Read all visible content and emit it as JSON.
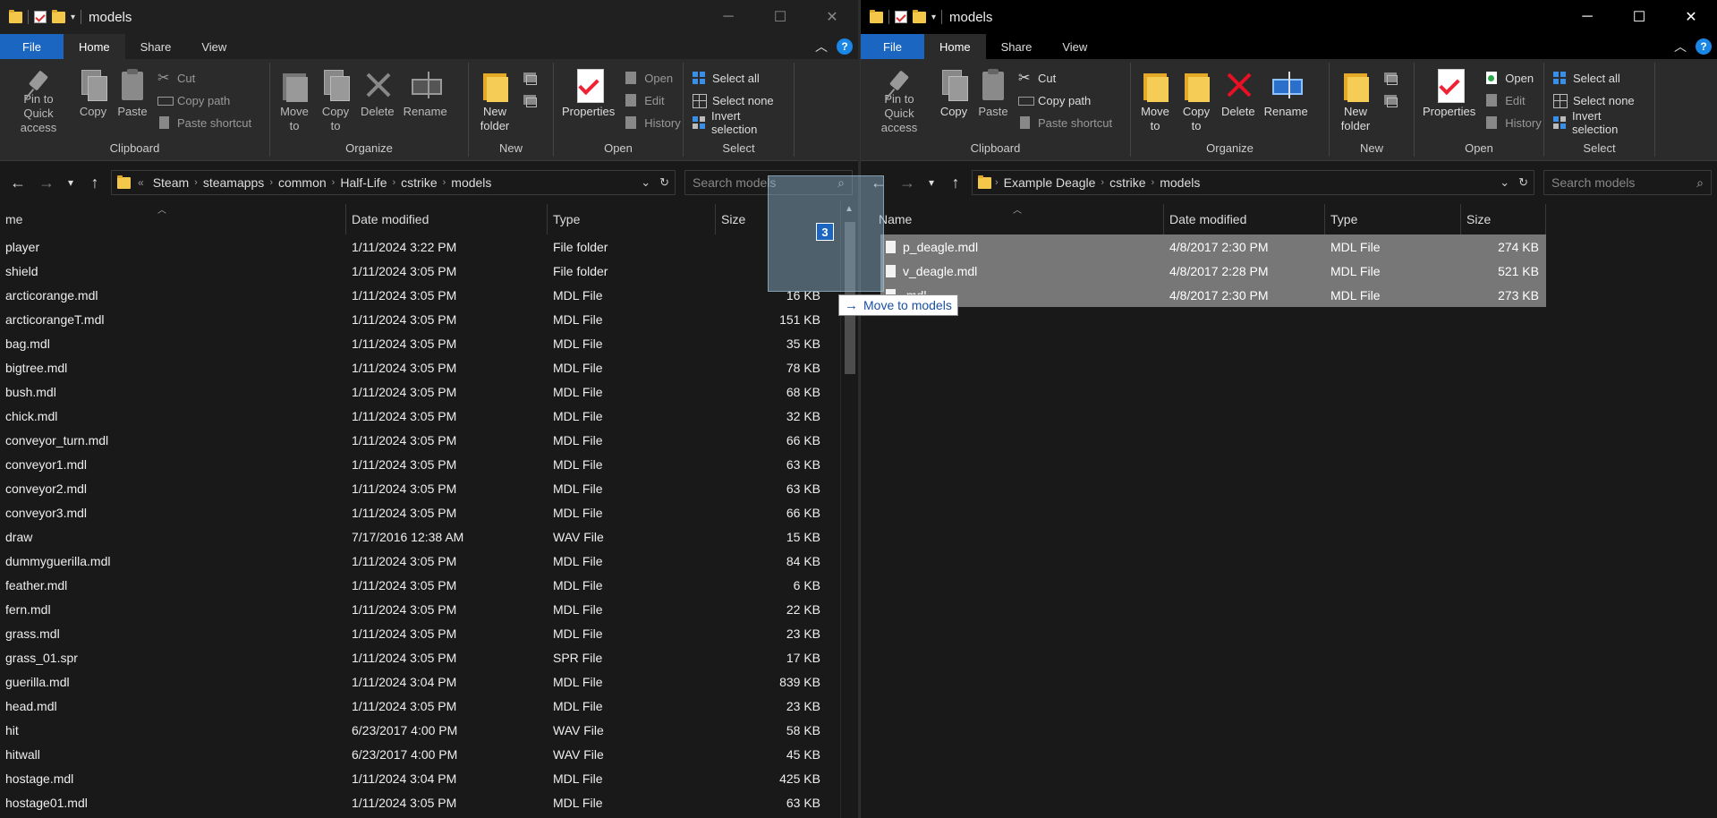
{
  "left": {
    "title": "models",
    "tabs": [
      "File",
      "Home",
      "Share",
      "View"
    ],
    "ribbon": {
      "clipboard": {
        "pin": "Pin to Quick access",
        "copy": "Copy",
        "paste": "Paste",
        "cut": "Cut",
        "copy_path": "Copy path",
        "paste_shortcut": "Paste shortcut",
        "label": "Clipboard"
      },
      "organize": {
        "move_to": "Move to",
        "copy_to": "Copy to",
        "delete": "Delete",
        "rename": "Rename",
        "label": "Organize"
      },
      "new": {
        "new_folder": "New folder",
        "label": "New"
      },
      "open": {
        "properties": "Properties",
        "open": "Open",
        "edit": "Edit",
        "history": "History",
        "label": "Open"
      },
      "select": {
        "select_all": "Select all",
        "select_none": "Select none",
        "invert": "Invert selection",
        "label": "Select"
      }
    },
    "address": {
      "overflow": "«",
      "crumbs": [
        "Steam",
        "steamapps",
        "common",
        "Half-Life",
        "cstrike",
        "models"
      ]
    },
    "search_placeholder": "Search models",
    "columns": {
      "name": "me",
      "date": "Date modified",
      "type": "Type",
      "size": "Size"
    },
    "files": [
      {
        "name": "player",
        "date": "1/11/2024 3:22 PM",
        "type": "File folder",
        "size": ""
      },
      {
        "name": "shield",
        "date": "1/11/2024 3:05 PM",
        "type": "File folder",
        "size": ""
      },
      {
        "name": "arcticorange.mdl",
        "date": "1/11/2024 3:05 PM",
        "type": "MDL File",
        "size": "16 KB"
      },
      {
        "name": "arcticorangeT.mdl",
        "date": "1/11/2024 3:05 PM",
        "type": "MDL File",
        "size": "151 KB"
      },
      {
        "name": "bag.mdl",
        "date": "1/11/2024 3:05 PM",
        "type": "MDL File",
        "size": "35 KB"
      },
      {
        "name": "bigtree.mdl",
        "date": "1/11/2024 3:05 PM",
        "type": "MDL File",
        "size": "78 KB"
      },
      {
        "name": "bush.mdl",
        "date": "1/11/2024 3:05 PM",
        "type": "MDL File",
        "size": "68 KB"
      },
      {
        "name": "chick.mdl",
        "date": "1/11/2024 3:05 PM",
        "type": "MDL File",
        "size": "32 KB"
      },
      {
        "name": "conveyor_turn.mdl",
        "date": "1/11/2024 3:05 PM",
        "type": "MDL File",
        "size": "66 KB"
      },
      {
        "name": "conveyor1.mdl",
        "date": "1/11/2024 3:05 PM",
        "type": "MDL File",
        "size": "63 KB"
      },
      {
        "name": "conveyor2.mdl",
        "date": "1/11/2024 3:05 PM",
        "type": "MDL File",
        "size": "63 KB"
      },
      {
        "name": "conveyor3.mdl",
        "date": "1/11/2024 3:05 PM",
        "type": "MDL File",
        "size": "66 KB"
      },
      {
        "name": "draw",
        "date": "7/17/2016 12:38 AM",
        "type": "WAV File",
        "size": "15 KB"
      },
      {
        "name": "dummyguerilla.mdl",
        "date": "1/11/2024 3:05 PM",
        "type": "MDL File",
        "size": "84 KB"
      },
      {
        "name": "feather.mdl",
        "date": "1/11/2024 3:05 PM",
        "type": "MDL File",
        "size": "6 KB"
      },
      {
        "name": "fern.mdl",
        "date": "1/11/2024 3:05 PM",
        "type": "MDL File",
        "size": "22 KB"
      },
      {
        "name": "grass.mdl",
        "date": "1/11/2024 3:05 PM",
        "type": "MDL File",
        "size": "23 KB"
      },
      {
        "name": "grass_01.spr",
        "date": "1/11/2024 3:05 PM",
        "type": "SPR File",
        "size": "17 KB"
      },
      {
        "name": "guerilla.mdl",
        "date": "1/11/2024 3:04 PM",
        "type": "MDL File",
        "size": "839 KB"
      },
      {
        "name": "head.mdl",
        "date": "1/11/2024 3:05 PM",
        "type": "MDL File",
        "size": "23 KB"
      },
      {
        "name": "hit",
        "date": "6/23/2017 4:00 PM",
        "type": "WAV File",
        "size": "58 KB"
      },
      {
        "name": "hitwall",
        "date": "6/23/2017 4:00 PM",
        "type": "WAV File",
        "size": "45 KB"
      },
      {
        "name": "hostage.mdl",
        "date": "1/11/2024 3:04 PM",
        "type": "MDL File",
        "size": "425 KB"
      },
      {
        "name": "hostage01.mdl",
        "date": "1/11/2024 3:05 PM",
        "type": "MDL File",
        "size": "63 KB"
      }
    ]
  },
  "right": {
    "title": "models",
    "tabs": [
      "File",
      "Home",
      "Share",
      "View"
    ],
    "ribbon": {
      "clipboard": {
        "pin": "Pin to Quick access",
        "copy": "Copy",
        "paste": "Paste",
        "cut": "Cut",
        "copy_path": "Copy path",
        "paste_shortcut": "Paste shortcut",
        "label": "Clipboard"
      },
      "organize": {
        "move_to": "Move to",
        "copy_to": "Copy to",
        "delete": "Delete",
        "rename": "Rename",
        "label": "Organize"
      },
      "new": {
        "new_folder": "New folder",
        "label": "New"
      },
      "open": {
        "properties": "Properties",
        "open": "Open",
        "edit": "Edit",
        "history": "History",
        "label": "Open"
      },
      "select": {
        "select_all": "Select all",
        "select_none": "Select none",
        "invert": "Invert selection",
        "label": "Select"
      }
    },
    "address": {
      "crumbs": [
        "Example Deagle",
        "cstrike",
        "models"
      ]
    },
    "search_placeholder": "Search models",
    "columns": {
      "name": "Name",
      "date": "Date modified",
      "type": "Type",
      "size": "Size"
    },
    "files": [
      {
        "name": "p_deagle.mdl",
        "date": "4/8/2017 2:30 PM",
        "type": "MDL File",
        "size": "274 KB"
      },
      {
        "name": "v_deagle.mdl",
        "date": "4/8/2017 2:28 PM",
        "type": "MDL File",
        "size": "521 KB"
      },
      {
        "name": ".mdl",
        "date": "4/8/2017 2:30 PM",
        "type": "MDL File",
        "size": "273 KB"
      }
    ]
  },
  "drag": {
    "count": "3",
    "tooltip": "Move to models"
  },
  "colors": {
    "file_tab": "#1a66c0",
    "accent": "#1a86e6",
    "selection": "#777777"
  }
}
